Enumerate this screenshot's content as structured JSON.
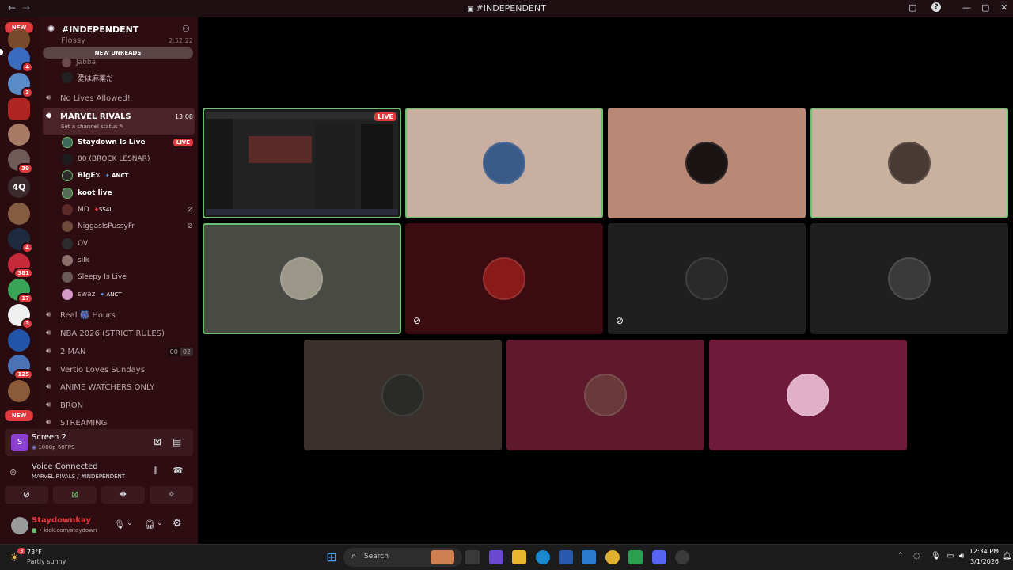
{
  "titlebar": {
    "title": "#INDEPENDENT",
    "back_icon": "arrow-left-icon",
    "forward_icon": "arrow-right-icon"
  },
  "rail": {
    "new_top": "NEW",
    "new_bottom": "NEW",
    "server_4q": "4Q",
    "badges": [
      "4",
      "3",
      "39",
      "4",
      "381",
      "17",
      "3",
      "125"
    ]
  },
  "guild": {
    "name": "#INDEPENDENT",
    "new_unreads": "NEW UNREADS",
    "partial_channel": "Flossy",
    "partial_time": "2:52:22",
    "partial_user1": "Jabba",
    "partial_user2": "愛は麻薬だ"
  },
  "channels": [
    {
      "name": "No Lives Allowed!"
    },
    {
      "name": "MARVEL RIVALS",
      "time": "13:08",
      "status": "Set a channel status"
    },
    {
      "name": "Real 🎆 Hours"
    },
    {
      "name": "NBA 2026 (STRICT RULES)"
    },
    {
      "name": "2 MAN",
      "count_a": "00",
      "count_b": "02"
    },
    {
      "name": "Vertio Loves Sundays"
    },
    {
      "name": "ANIME WATCHERS ONLY"
    },
    {
      "name": "BRON"
    },
    {
      "name": "STREAMING"
    }
  ],
  "voice_users": [
    {
      "name": "Staydown Is Live",
      "live": "LIVE"
    },
    {
      "name": "00 (BROCK LESNAR)"
    },
    {
      "name": "BigE𝕩",
      "tag": "ANCT"
    },
    {
      "name": "koot live"
    },
    {
      "name": "MD",
      "tag": "SS4L"
    },
    {
      "name": "NiggasIsPussyFr"
    },
    {
      "name": "OV"
    },
    {
      "name": "silk"
    },
    {
      "name": "Sleepy Is Live"
    },
    {
      "name": "swaz",
      "tag": "ANCT"
    }
  ],
  "screen_panel": {
    "title": "Screen 2",
    "quality": "1080p 60FPS"
  },
  "voice_panel": {
    "status": "Voice Connected",
    "location": "MARVEL RIVALS / #INDEPENDENT"
  },
  "user_panel": {
    "username": "Staydownkay",
    "status": "kick.com/staydown"
  },
  "stream_tile": {
    "live": "LIVE"
  },
  "taskbar": {
    "weather_temp": "73°F",
    "weather_desc": "Partly sunny",
    "weather_badge": "3",
    "search": "Search",
    "time": "12:34 PM",
    "date": "3/1/2026"
  },
  "colors": {
    "accent_live": "#e03a3e",
    "speaking": "#6fbf73",
    "sidebar": "#2e0d12",
    "rail": "#2a0c10"
  }
}
